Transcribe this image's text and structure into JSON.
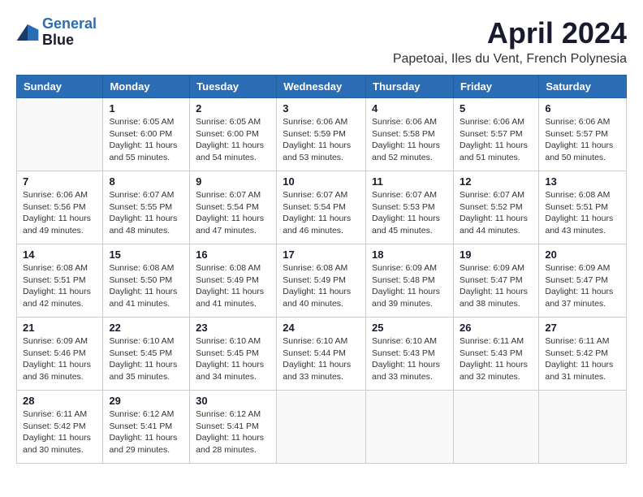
{
  "header": {
    "logo_line1": "General",
    "logo_line2": "Blue",
    "month_year": "April 2024",
    "location": "Papetoai, Iles du Vent, French Polynesia"
  },
  "days_of_week": [
    "Sunday",
    "Monday",
    "Tuesday",
    "Wednesday",
    "Thursday",
    "Friday",
    "Saturday"
  ],
  "weeks": [
    [
      {
        "day": "",
        "info": ""
      },
      {
        "day": "1",
        "info": "Sunrise: 6:05 AM\nSunset: 6:00 PM\nDaylight: 11 hours\nand 55 minutes."
      },
      {
        "day": "2",
        "info": "Sunrise: 6:05 AM\nSunset: 6:00 PM\nDaylight: 11 hours\nand 54 minutes."
      },
      {
        "day": "3",
        "info": "Sunrise: 6:06 AM\nSunset: 5:59 PM\nDaylight: 11 hours\nand 53 minutes."
      },
      {
        "day": "4",
        "info": "Sunrise: 6:06 AM\nSunset: 5:58 PM\nDaylight: 11 hours\nand 52 minutes."
      },
      {
        "day": "5",
        "info": "Sunrise: 6:06 AM\nSunset: 5:57 PM\nDaylight: 11 hours\nand 51 minutes."
      },
      {
        "day": "6",
        "info": "Sunrise: 6:06 AM\nSunset: 5:57 PM\nDaylight: 11 hours\nand 50 minutes."
      }
    ],
    [
      {
        "day": "7",
        "info": "Sunrise: 6:06 AM\nSunset: 5:56 PM\nDaylight: 11 hours\nand 49 minutes."
      },
      {
        "day": "8",
        "info": "Sunrise: 6:07 AM\nSunset: 5:55 PM\nDaylight: 11 hours\nand 48 minutes."
      },
      {
        "day": "9",
        "info": "Sunrise: 6:07 AM\nSunset: 5:54 PM\nDaylight: 11 hours\nand 47 minutes."
      },
      {
        "day": "10",
        "info": "Sunrise: 6:07 AM\nSunset: 5:54 PM\nDaylight: 11 hours\nand 46 minutes."
      },
      {
        "day": "11",
        "info": "Sunrise: 6:07 AM\nSunset: 5:53 PM\nDaylight: 11 hours\nand 45 minutes."
      },
      {
        "day": "12",
        "info": "Sunrise: 6:07 AM\nSunset: 5:52 PM\nDaylight: 11 hours\nand 44 minutes."
      },
      {
        "day": "13",
        "info": "Sunrise: 6:08 AM\nSunset: 5:51 PM\nDaylight: 11 hours\nand 43 minutes."
      }
    ],
    [
      {
        "day": "14",
        "info": "Sunrise: 6:08 AM\nSunset: 5:51 PM\nDaylight: 11 hours\nand 42 minutes."
      },
      {
        "day": "15",
        "info": "Sunrise: 6:08 AM\nSunset: 5:50 PM\nDaylight: 11 hours\nand 41 minutes."
      },
      {
        "day": "16",
        "info": "Sunrise: 6:08 AM\nSunset: 5:49 PM\nDaylight: 11 hours\nand 41 minutes."
      },
      {
        "day": "17",
        "info": "Sunrise: 6:08 AM\nSunset: 5:49 PM\nDaylight: 11 hours\nand 40 minutes."
      },
      {
        "day": "18",
        "info": "Sunrise: 6:09 AM\nSunset: 5:48 PM\nDaylight: 11 hours\nand 39 minutes."
      },
      {
        "day": "19",
        "info": "Sunrise: 6:09 AM\nSunset: 5:47 PM\nDaylight: 11 hours\nand 38 minutes."
      },
      {
        "day": "20",
        "info": "Sunrise: 6:09 AM\nSunset: 5:47 PM\nDaylight: 11 hours\nand 37 minutes."
      }
    ],
    [
      {
        "day": "21",
        "info": "Sunrise: 6:09 AM\nSunset: 5:46 PM\nDaylight: 11 hours\nand 36 minutes."
      },
      {
        "day": "22",
        "info": "Sunrise: 6:10 AM\nSunset: 5:45 PM\nDaylight: 11 hours\nand 35 minutes."
      },
      {
        "day": "23",
        "info": "Sunrise: 6:10 AM\nSunset: 5:45 PM\nDaylight: 11 hours\nand 34 minutes."
      },
      {
        "day": "24",
        "info": "Sunrise: 6:10 AM\nSunset: 5:44 PM\nDaylight: 11 hours\nand 33 minutes."
      },
      {
        "day": "25",
        "info": "Sunrise: 6:10 AM\nSunset: 5:43 PM\nDaylight: 11 hours\nand 33 minutes."
      },
      {
        "day": "26",
        "info": "Sunrise: 6:11 AM\nSunset: 5:43 PM\nDaylight: 11 hours\nand 32 minutes."
      },
      {
        "day": "27",
        "info": "Sunrise: 6:11 AM\nSunset: 5:42 PM\nDaylight: 11 hours\nand 31 minutes."
      }
    ],
    [
      {
        "day": "28",
        "info": "Sunrise: 6:11 AM\nSunset: 5:42 PM\nDaylight: 11 hours\nand 30 minutes."
      },
      {
        "day": "29",
        "info": "Sunrise: 6:12 AM\nSunset: 5:41 PM\nDaylight: 11 hours\nand 29 minutes."
      },
      {
        "day": "30",
        "info": "Sunrise: 6:12 AM\nSunset: 5:41 PM\nDaylight: 11 hours\nand 28 minutes."
      },
      {
        "day": "",
        "info": ""
      },
      {
        "day": "",
        "info": ""
      },
      {
        "day": "",
        "info": ""
      },
      {
        "day": "",
        "info": ""
      }
    ]
  ]
}
